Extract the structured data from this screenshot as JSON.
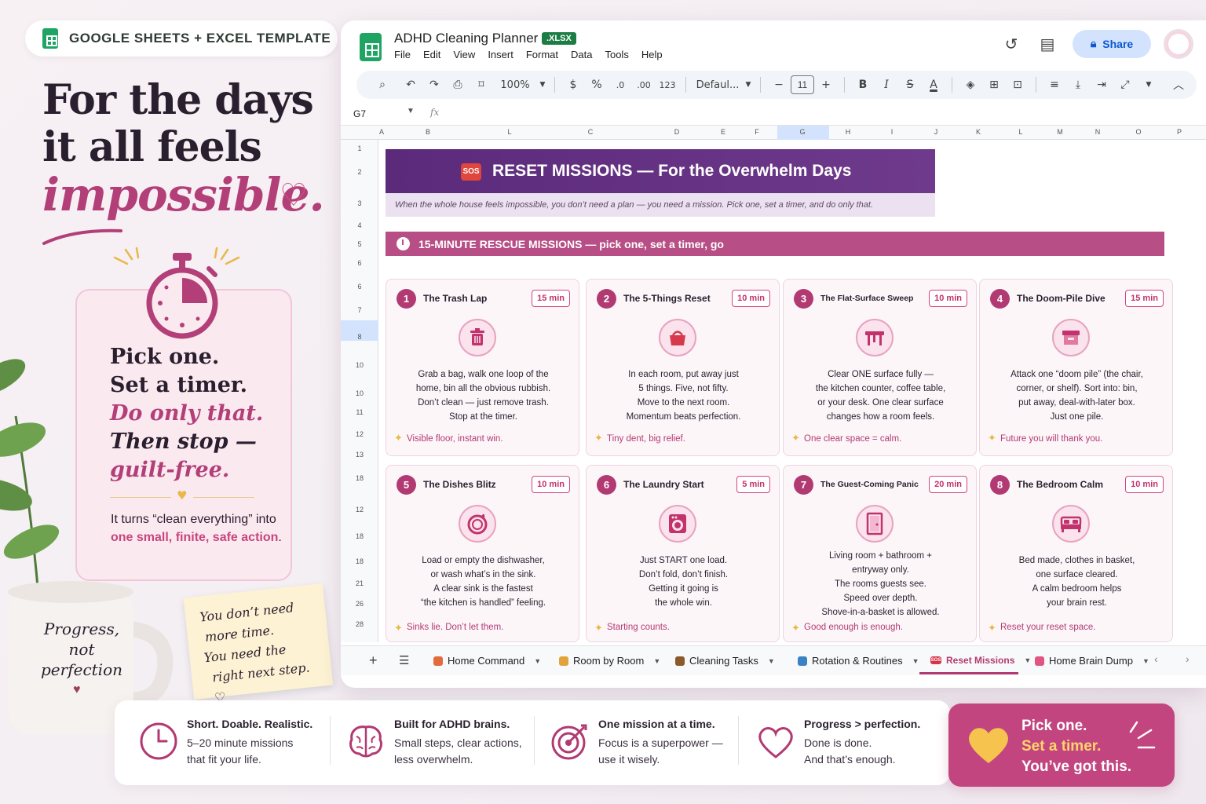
{
  "badge": {
    "text": "GOOGLE SHEETS + EXCEL TEMPLATE"
  },
  "headline": {
    "line1": "For the days",
    "line2": "it all feels",
    "line3": "impossible."
  },
  "timer_card": {
    "line1": "Pick one.",
    "line2": "Set a timer.",
    "line3": "Do only that.",
    "line4": "Then stop —",
    "line5": "guilt-free.",
    "turns_prefix": "It turns “clean everything” into ",
    "turns_pink": "one small, finite, safe action",
    "turns_suffix": "."
  },
  "mug": {
    "line1": "Progress,",
    "line2": "not",
    "line3": "perfection"
  },
  "sticky": {
    "line1": "You don’t need",
    "line2": "more time.",
    "line3": "You need the",
    "line4": "right next step."
  },
  "app": {
    "title": "ADHD Cleaning Planner",
    "format_badge": ".XLSX",
    "menu": [
      "File",
      "Edit",
      "View",
      "Insert",
      "Format",
      "Data",
      "Tools",
      "Help"
    ],
    "share_label": "Share",
    "zoom": "100%",
    "currency": "$",
    "percent": "%",
    "dec_dec": ".0",
    "dec_inc": ".00",
    "num_format": "123",
    "font": "Defaul...",
    "font_size": "11",
    "cell_ref": "G7",
    "fx": "fx"
  },
  "columns": [
    "A",
    "B",
    "L",
    "C",
    "D",
    "E",
    "F",
    "G",
    "H",
    "I",
    "J",
    "K",
    "L",
    "M",
    "N",
    "O",
    "P"
  ],
  "rows": [
    "1",
    "2",
    "3",
    "4",
    "5",
    "6",
    "6",
    "7",
    "8",
    "10",
    "10",
    "11",
    "12",
    "13",
    "18",
    "12",
    "18",
    "18",
    "21",
    "26",
    "28"
  ],
  "sheet": {
    "sos": "SOS",
    "banner_title": "RESET MISSIONS — For the Overwhelm Days",
    "subtitle": "When the whole house feels impossible, you don’t need a plan — you need a mission. Pick one, set a timer, and do only that.",
    "section_title": "15-MINUTE RESCUE MISSIONS — pick one, set a timer, go"
  },
  "cards": [
    {
      "num": "1",
      "title": "The Trash Lap",
      "time": "15 min",
      "icon": "trash-icon",
      "desc": [
        "Grab a bag, walk one loop of the",
        "home, bin all the obvious rubbish.",
        "Don’t clean — just remove trash.",
        "Stop at the timer."
      ],
      "tip": "Visible floor, instant win."
    },
    {
      "num": "2",
      "title": "The 5-Things Reset",
      "time": "10 min",
      "icon": "basket-icon",
      "desc": [
        "In each room, put away just",
        "5 things. Five, not fifty.",
        "Move to the next room.",
        "Momentum beats perfection."
      ],
      "tip": "Tiny dent, big relief."
    },
    {
      "num": "3",
      "title": "The Flat-Surface Sweep",
      "time": "10 min",
      "icon": "table-icon",
      "desc": [
        "Clear ONE surface fully —",
        "the kitchen counter, coffee table,",
        "or your desk. One clear surface",
        "changes how a room feels."
      ],
      "tip": "One clear space = calm."
    },
    {
      "num": "4",
      "title": "The Doom-Pile Dive",
      "time": "15 min",
      "icon": "box-icon",
      "desc": [
        "Attack one “doom pile” (the chair,",
        "corner, or shelf). Sort into: bin,",
        "put away, deal-with-later box.",
        "Just one pile."
      ],
      "tip": "Future you will thank you."
    },
    {
      "num": "5",
      "title": "The Dishes Blitz",
      "time": "10 min",
      "icon": "plate-icon",
      "desc": [
        "Load or empty the dishwasher,",
        "or wash what’s in the sink.",
        "A clear sink is the fastest",
        "“the kitchen is handled” feeling."
      ],
      "tip": "Sinks lie. Don’t let them."
    },
    {
      "num": "6",
      "title": "The Laundry Start",
      "time": "5 min",
      "icon": "washing-machine-icon",
      "desc": [
        "Just START one load.",
        "Don’t fold, don’t finish.",
        "Getting it going is",
        "the whole win."
      ],
      "tip": "Starting counts."
    },
    {
      "num": "7",
      "title": "The Guest-Coming Panic",
      "time": "20 min",
      "icon": "door-icon",
      "desc": [
        "Living room + bathroom +",
        "entryway only.",
        "The rooms guests see.",
        "Speed over depth.",
        "Shove-in-a-basket is allowed."
      ],
      "tip": "Good enough is enough."
    },
    {
      "num": "8",
      "title": "The Bedroom Calm",
      "time": "10 min",
      "icon": "bed-icon",
      "desc": [
        "Bed made, clothes in basket,",
        "one surface cleared.",
        "A calm bedroom helps",
        "your brain rest."
      ],
      "tip": "Reset your reset space."
    }
  ],
  "tabs": [
    {
      "label": "Home Command",
      "color": "#e26b3b"
    },
    {
      "label": "Room by Room",
      "color": "#e0a43a"
    },
    {
      "label": "Cleaning Tasks",
      "color": "#8a5a2b"
    },
    {
      "label": "Rotation & Routines",
      "color": "#3b82c4"
    },
    {
      "label": "Reset Missions",
      "color": "#d6344b",
      "badge": "SOS"
    },
    {
      "label": "Home Brain Dump",
      "color": "#e05680"
    }
  ],
  "features": [
    {
      "title": "Short. Doable. Realistic.",
      "line1": "5–20 minute missions",
      "line2": "that fit your life.",
      "icon": "clock-icon"
    },
    {
      "title": "Built for ADHD brains.",
      "line1": "Small steps, clear actions,",
      "line2": "less overwhelm.",
      "icon": "brain-icon"
    },
    {
      "title": "One mission at a time.",
      "line1": "Focus is a superpower —",
      "line2": "use it wisely.",
      "icon": "target-icon"
    },
    {
      "title": "Progress > perfection.",
      "line1": "Done is done.",
      "line2": "And that’s enough.",
      "icon": "heart-icon"
    }
  ],
  "cta": {
    "line1": "Pick one.",
    "line2": "Set a timer.",
    "line3": "You’ve got this."
  },
  "colors": {
    "accent": "#b23a72",
    "banner": "#5b2a7a",
    "section": "#b74e85",
    "cta": "#c2457f"
  }
}
